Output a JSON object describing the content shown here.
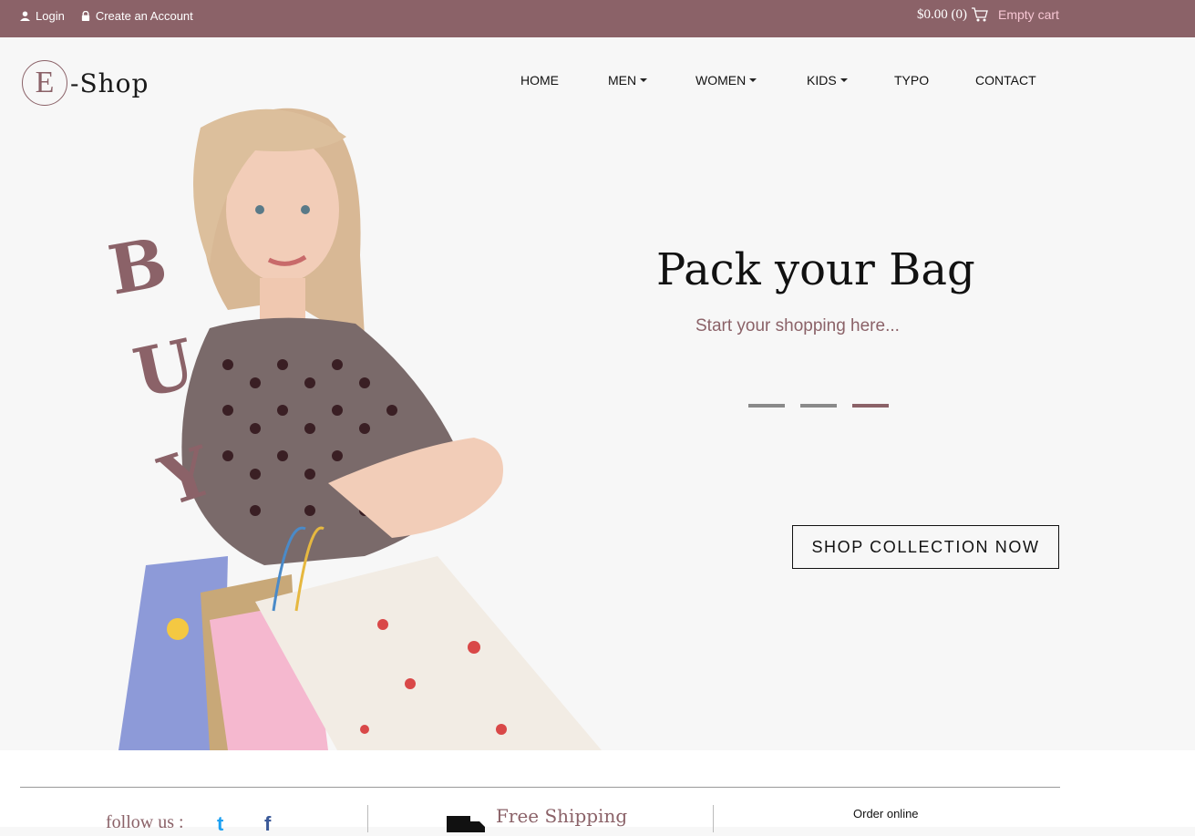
{
  "topbar": {
    "login_label": "Login",
    "create_account_label": "Create an Account",
    "cart_total": "$0.00 (0)",
    "empty_cart_label": "Empty cart"
  },
  "logo": {
    "letter": "E",
    "text": "-Shop"
  },
  "nav": {
    "items": [
      {
        "label": "HOME",
        "dropdown": false
      },
      {
        "label": "MEN",
        "dropdown": true
      },
      {
        "label": "WOMEN",
        "dropdown": true
      },
      {
        "label": "KIDS",
        "dropdown": true
      },
      {
        "label": "TYPO",
        "dropdown": false
      },
      {
        "label": "CONTACT",
        "dropdown": false
      }
    ]
  },
  "hero": {
    "buy_letters": [
      "B",
      "U",
      "Y"
    ],
    "headline": "Pack your Bag",
    "subline": "Start your shopping here...",
    "slides": 3,
    "active_slide": 3,
    "cta_label": "SHOP COLLECTION NOW"
  },
  "footer": {
    "follow_label": "follow us :",
    "twitter_glyph": "t",
    "facebook_glyph": "f",
    "shipping_title": "Free Shipping",
    "order_title": "Order online"
  },
  "colors": {
    "brand": "#8b6268",
    "topbar_bg": "#8b6268",
    "empty_cart": "#f7c6d3",
    "twitter": "#1da1f2",
    "facebook": "#3b5998"
  },
  "icons": {
    "login": "user-icon",
    "create_account": "lock-icon",
    "cart": "cart-icon",
    "shipping": "truck-icon"
  }
}
